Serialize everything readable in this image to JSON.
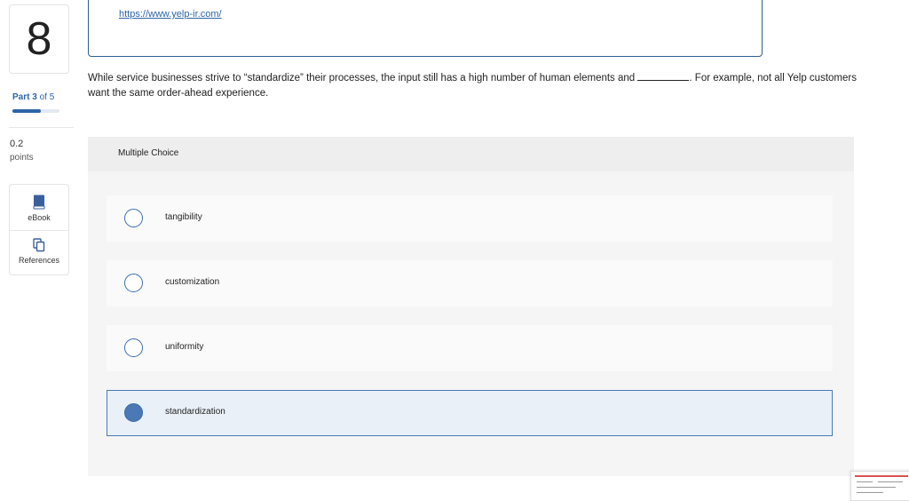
{
  "question_number": "8",
  "part": {
    "prefix": "Part",
    "current": "3",
    "of_text": "of 5",
    "progress_fraction": 0.6
  },
  "points": {
    "value": "0.2",
    "label": "points"
  },
  "tools": {
    "ebook": "eBook",
    "references": "References"
  },
  "reference_url": "https://www.yelp-ir.com/",
  "question": {
    "before_blank": "While service businesses strive to “standardize” their processes, the input still has a high number of human elements and",
    "after_blank": ". For example, not all Yelp customers want the same order-ahead experience."
  },
  "multiple_choice": {
    "title": "Multiple Choice",
    "options": [
      {
        "label": "tangibility",
        "selected": false
      },
      {
        "label": "customization",
        "selected": false
      },
      {
        "label": "uniformity",
        "selected": false
      },
      {
        "label": "standardization",
        "selected": true
      }
    ]
  },
  "colors": {
    "accent": "#2d65a6",
    "selected_bg": "#e9f0f8",
    "selected_radio": "#4a79b6"
  },
  "icons": {
    "ebook": "book-icon",
    "references": "copy-icon"
  }
}
